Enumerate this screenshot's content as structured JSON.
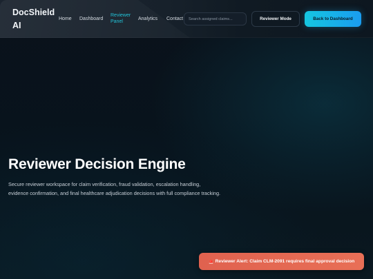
{
  "nav": {
    "logo_line1": "DocShield",
    "logo_line2": "AI",
    "links": [
      {
        "label": "Home"
      },
      {
        "label": "Dashboard"
      },
      {
        "label_line1": "Reviewer",
        "label_line2": "Panel",
        "active": true
      },
      {
        "label": "Analytics"
      },
      {
        "label": "Contact"
      }
    ],
    "search_placeholder": "Search assigned claims...",
    "reviewer_mode_label": "Reviewer Mode",
    "back_label": "Back to Dashboard"
  },
  "hero": {
    "title": "Reviewer Decision Engine",
    "description": "Secure reviewer workspace for claim verification, fraud validation, escalation handling, evidence confirmation, and final healthcare adjudication decisions with full compliance tracking."
  },
  "toast": {
    "icon": "alert-siren-icon",
    "text": "Reviewer Alert: Claim CLM-2091 requires final approval decision"
  },
  "colors": {
    "accent": "#22c3d8",
    "primary_gradient_start": "#15c6e0",
    "primary_gradient_end": "#1a9cf0",
    "alert": "#e0624f"
  }
}
